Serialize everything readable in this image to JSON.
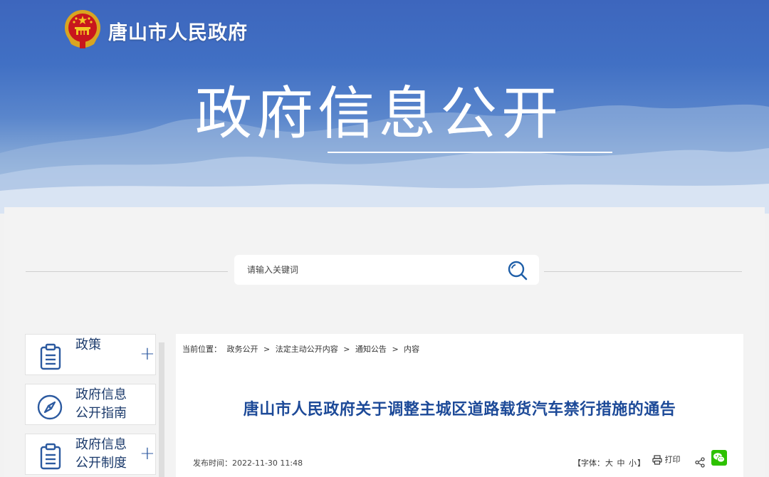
{
  "header": {
    "site_name": "唐山市人民政府",
    "banner_title": "政府信息公开",
    "emblem_icon": "national-emblem-icon"
  },
  "search": {
    "placeholder": "请输入关键词",
    "button_icon": "search-icon"
  },
  "sidebar": {
    "items": [
      {
        "label": "政策",
        "icon": "clipboard-list-icon",
        "expandable": true
      },
      {
        "label": "政府信息\n公开指南",
        "icon": "compass-icon",
        "expandable": false
      },
      {
        "label": "政府信息\n公开制度",
        "icon": "clipboard-list-icon",
        "expandable": true
      }
    ]
  },
  "breadcrumb": {
    "prefix": "当前位置：",
    "items": [
      "政务公开",
      "法定主动公开内容",
      "通知公告",
      "内容"
    ],
    "separator": ">"
  },
  "article": {
    "title": "唐山市人民政府关于调整主城区道路载货汽车禁行措施的通告",
    "publish_label": "发布时间：",
    "publish_time": "2022-11-30 11:48",
    "font_label_open": "【字体：",
    "font_large": "大",
    "font_medium": "中",
    "font_small": "小",
    "font_label_close": "】",
    "print_label": "打印"
  },
  "colors": {
    "banner_top": "#3d66bd",
    "title_blue": "#1d4a98",
    "icon_blue": "#2c5aa0",
    "wechat_green": "#2dc100"
  }
}
